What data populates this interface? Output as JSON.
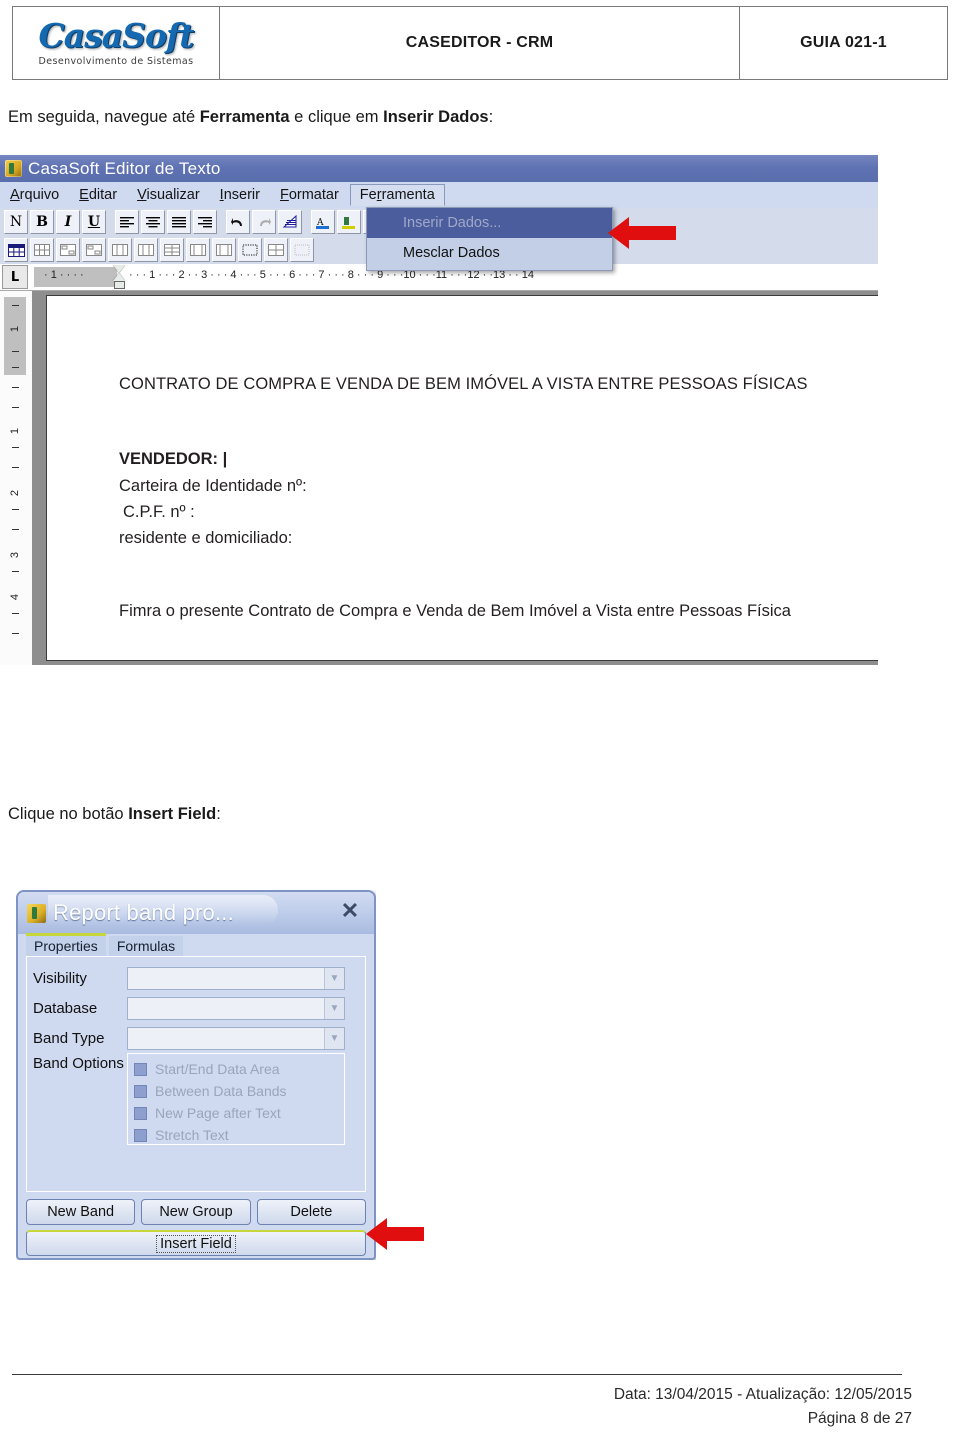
{
  "header": {
    "logo_word": "CasaSoft",
    "logo_sub": "Desenvolvimento de Sistemas",
    "title": "CASEDITOR - CRM",
    "guia": "GUIA 021-1"
  },
  "paragraphs": {
    "p1_a": "Em seguida, navegue até ",
    "p1_b": "Ferramenta",
    "p1_c": " e clique em ",
    "p1_d": "Inserir Dados",
    "p1_e": ":",
    "p2_a": "Clique no botão ",
    "p2_b": "Insert Field",
    "p2_c": ":"
  },
  "editor": {
    "title": "CasaSoft Editor de Texto",
    "menus": [
      {
        "label": "Arquivo",
        "open": false
      },
      {
        "label": "Editar",
        "open": false
      },
      {
        "label": "Visualizar",
        "open": false
      },
      {
        "label": "Inserir",
        "open": false
      },
      {
        "label": "Formatar",
        "open": false
      },
      {
        "label": "Ferramenta",
        "open": true
      }
    ],
    "dropdown": {
      "items": [
        {
          "label": "Inserir Dados...",
          "selected": true
        },
        {
          "label": "Mesclar Dados",
          "selected": false
        }
      ]
    },
    "toolbar_row1": [
      "N",
      "B",
      "I",
      "U"
    ],
    "ruler": {
      "corner_label": "L",
      "ticks": [
        "1",
        "1",
        "2",
        "3",
        "4",
        "5",
        "6",
        "7",
        "8",
        "9",
        "10",
        "11",
        "12",
        "13",
        "14"
      ],
      "vticks": [
        "1",
        "1",
        "2",
        "3",
        "4"
      ]
    },
    "document": {
      "title_line": "CONTRATO DE COMPRA E VENDA DE BEM IMÓVEL A VISTA ENTRE PESSOAS FÍSICAS",
      "vendedor": "VENDEDOR: |",
      "line2": "Carteira de Identidade nº:",
      "line3": "C.P.F. nº :",
      "line4": "residente e domiciliado:",
      "line5": "Fimra o presente Contrato de Compra e Venda de Bem Imóvel a Vista entre Pessoas Física"
    }
  },
  "dialog": {
    "title": "Report band pro...",
    "close_label": "✕",
    "tabs": [
      {
        "label": "Properties",
        "active": true
      },
      {
        "label": "Formulas",
        "active": false
      }
    ],
    "fields": [
      {
        "label": "Visibility",
        "value": ""
      },
      {
        "label": "Database",
        "value": ""
      },
      {
        "label": "Band Type",
        "value": ""
      }
    ],
    "band_options_label": "Band Options",
    "band_options": [
      {
        "label": "Start/End Data Area",
        "checked": false
      },
      {
        "label": "Between Data Bands",
        "checked": false
      },
      {
        "label": "New Page after Text",
        "checked": false
      },
      {
        "label": "Stretch Text",
        "checked": false
      }
    ],
    "buttons": [
      {
        "label": "New Band"
      },
      {
        "label": "New Group"
      },
      {
        "label": "Delete"
      }
    ],
    "insert_field_label": "Insert Field"
  },
  "footer": {
    "line1": "Data: 13/04/2015  -  Atualização: 12/05/2015",
    "line2": "Página 8 de 27"
  },
  "colors": {
    "brand_blue": "#1569b0",
    "arrow_red": "#e00e0e",
    "titlebar_blue": "#5f72b3",
    "menu_bg": "#cfd9ef",
    "highlight": "#4c5d9e"
  }
}
